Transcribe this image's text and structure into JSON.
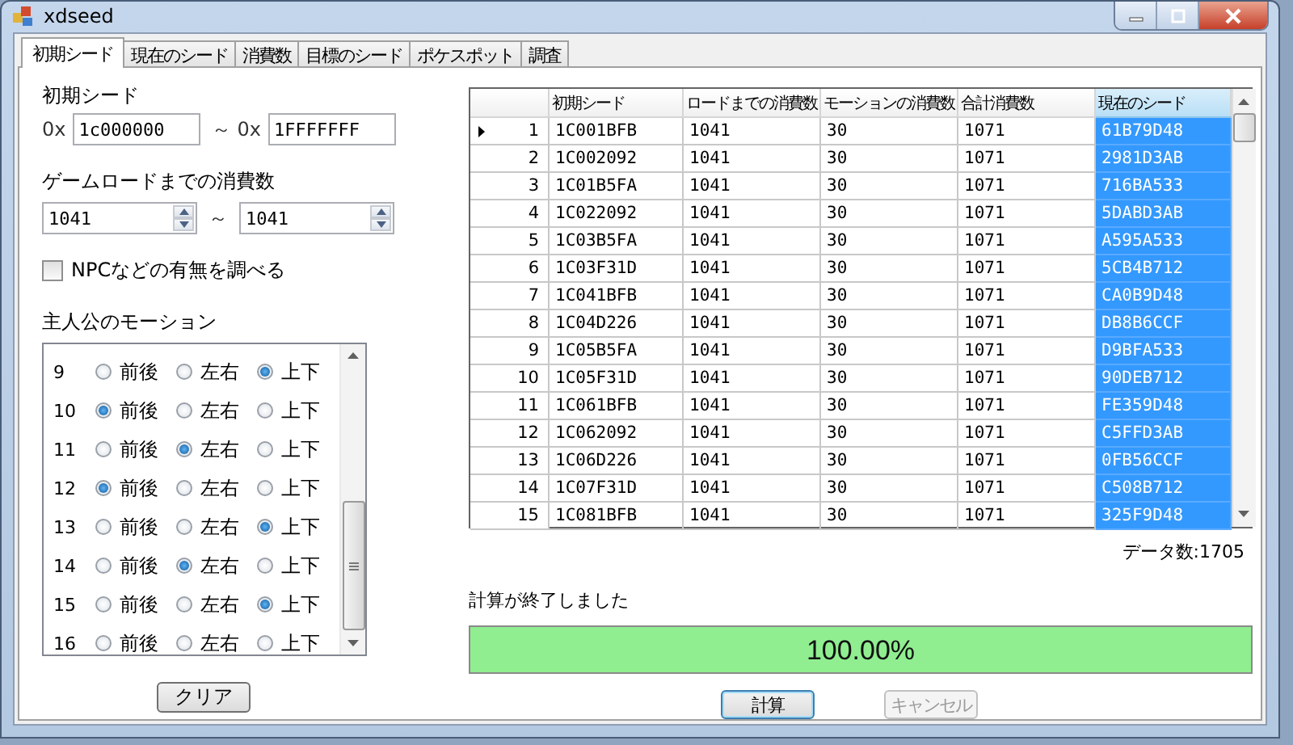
{
  "window": {
    "title": "xdseed"
  },
  "tabs": [
    {
      "label": "初期シード",
      "selected": true
    },
    {
      "label": "現在のシード",
      "selected": false
    },
    {
      "label": "消費数",
      "selected": false
    },
    {
      "label": "目標のシード",
      "selected": false
    },
    {
      "label": "ポケスポット",
      "selected": false
    },
    {
      "label": "調査",
      "selected": false
    }
  ],
  "seed_range": {
    "label": "初期シード",
    "from": {
      "prefix": "0x",
      "value": "1c000000"
    },
    "separator": "～",
    "to": {
      "prefix": "0x",
      "value": "1FFFFFFF"
    }
  },
  "load_count": {
    "label": "ゲームロードまでの消費数",
    "from": "1041",
    "separator": "～",
    "to": "1041"
  },
  "npc_check": {
    "label": "NPCなどの有無を調べる",
    "checked": false
  },
  "motion": {
    "label": "主人公のモーション",
    "rows": [
      {
        "number": "9",
        "options": [
          {
            "label": "前後",
            "selected": false
          },
          {
            "label": "左右",
            "selected": false
          },
          {
            "label": "上下",
            "selected": true
          }
        ]
      },
      {
        "number": "10",
        "options": [
          {
            "label": "前後",
            "selected": true
          },
          {
            "label": "左右",
            "selected": false
          },
          {
            "label": "上下",
            "selected": false
          }
        ]
      },
      {
        "number": "11",
        "options": [
          {
            "label": "前後",
            "selected": false
          },
          {
            "label": "左右",
            "selected": true
          },
          {
            "label": "上下",
            "selected": false
          }
        ]
      },
      {
        "number": "12",
        "options": [
          {
            "label": "前後",
            "selected": true
          },
          {
            "label": "左右",
            "selected": false
          },
          {
            "label": "上下",
            "selected": false
          }
        ]
      },
      {
        "number": "13",
        "options": [
          {
            "label": "前後",
            "selected": false
          },
          {
            "label": "左右",
            "selected": false
          },
          {
            "label": "上下",
            "selected": true
          }
        ]
      },
      {
        "number": "14",
        "options": [
          {
            "label": "前後",
            "selected": false
          },
          {
            "label": "左右",
            "selected": true
          },
          {
            "label": "上下",
            "selected": false
          }
        ]
      },
      {
        "number": "15",
        "options": [
          {
            "label": "前後",
            "selected": false
          },
          {
            "label": "左右",
            "selected": false
          },
          {
            "label": "上下",
            "selected": true
          }
        ]
      },
      {
        "number": "16",
        "options": [
          {
            "label": "前後",
            "selected": false
          },
          {
            "label": "左右",
            "selected": false
          },
          {
            "label": "上下",
            "selected": false
          }
        ]
      }
    ]
  },
  "clear_button": "クリア",
  "table": {
    "columns": [
      {
        "label": "初期シード",
        "selected": false
      },
      {
        "label": "ロードまでの消費数",
        "selected": false
      },
      {
        "label": "モーションの消費数",
        "selected": false
      },
      {
        "label": "合計消費数",
        "selected": false
      },
      {
        "label": "現在のシード",
        "selected": true
      }
    ],
    "rows": [
      {
        "number": "1",
        "current": true,
        "cells": [
          "1C001BFB",
          "1041",
          "30",
          "1071",
          "61B79D48"
        ]
      },
      {
        "number": "2",
        "current": false,
        "cells": [
          "1C002092",
          "1041",
          "30",
          "1071",
          "2981D3AB"
        ]
      },
      {
        "number": "3",
        "current": false,
        "cells": [
          "1C01B5FA",
          "1041",
          "30",
          "1071",
          "716BA533"
        ]
      },
      {
        "number": "4",
        "current": false,
        "cells": [
          "1C022092",
          "1041",
          "30",
          "1071",
          "5DABD3AB"
        ]
      },
      {
        "number": "5",
        "current": false,
        "cells": [
          "1C03B5FA",
          "1041",
          "30",
          "1071",
          "A595A533"
        ]
      },
      {
        "number": "6",
        "current": false,
        "cells": [
          "1C03F31D",
          "1041",
          "30",
          "1071",
          "5CB4B712"
        ]
      },
      {
        "number": "7",
        "current": false,
        "cells": [
          "1C041BFB",
          "1041",
          "30",
          "1071",
          "CA0B9D48"
        ]
      },
      {
        "number": "8",
        "current": false,
        "cells": [
          "1C04D226",
          "1041",
          "30",
          "1071",
          "DB8B6CCF"
        ]
      },
      {
        "number": "9",
        "current": false,
        "cells": [
          "1C05B5FA",
          "1041",
          "30",
          "1071",
          "D9BFA533"
        ]
      },
      {
        "number": "10",
        "current": false,
        "cells": [
          "1C05F31D",
          "1041",
          "30",
          "1071",
          "90DEB712"
        ]
      },
      {
        "number": "11",
        "current": false,
        "cells": [
          "1C061BFB",
          "1041",
          "30",
          "1071",
          "FE359D48"
        ]
      },
      {
        "number": "12",
        "current": false,
        "cells": [
          "1C062092",
          "1041",
          "30",
          "1071",
          "C5FFD3AB"
        ]
      },
      {
        "number": "13",
        "current": false,
        "cells": [
          "1C06D226",
          "1041",
          "30",
          "1071",
          "0FB56CCF"
        ]
      },
      {
        "number": "14",
        "current": false,
        "cells": [
          "1C07F31D",
          "1041",
          "30",
          "1071",
          "C508B712"
        ]
      },
      {
        "number": "15",
        "current": false,
        "cells": [
          "1C081BFB",
          "1041",
          "30",
          "1071",
          "325F9D48"
        ]
      }
    ]
  },
  "data_count": "データ数:1705",
  "status": "計算が終了しました",
  "progress": {
    "level": 1,
    "text": "100.00%"
  },
  "buttons": [
    {
      "label": "計算",
      "disabled": false
    },
    {
      "label": "キャンセル",
      "disabled": true
    }
  ]
}
